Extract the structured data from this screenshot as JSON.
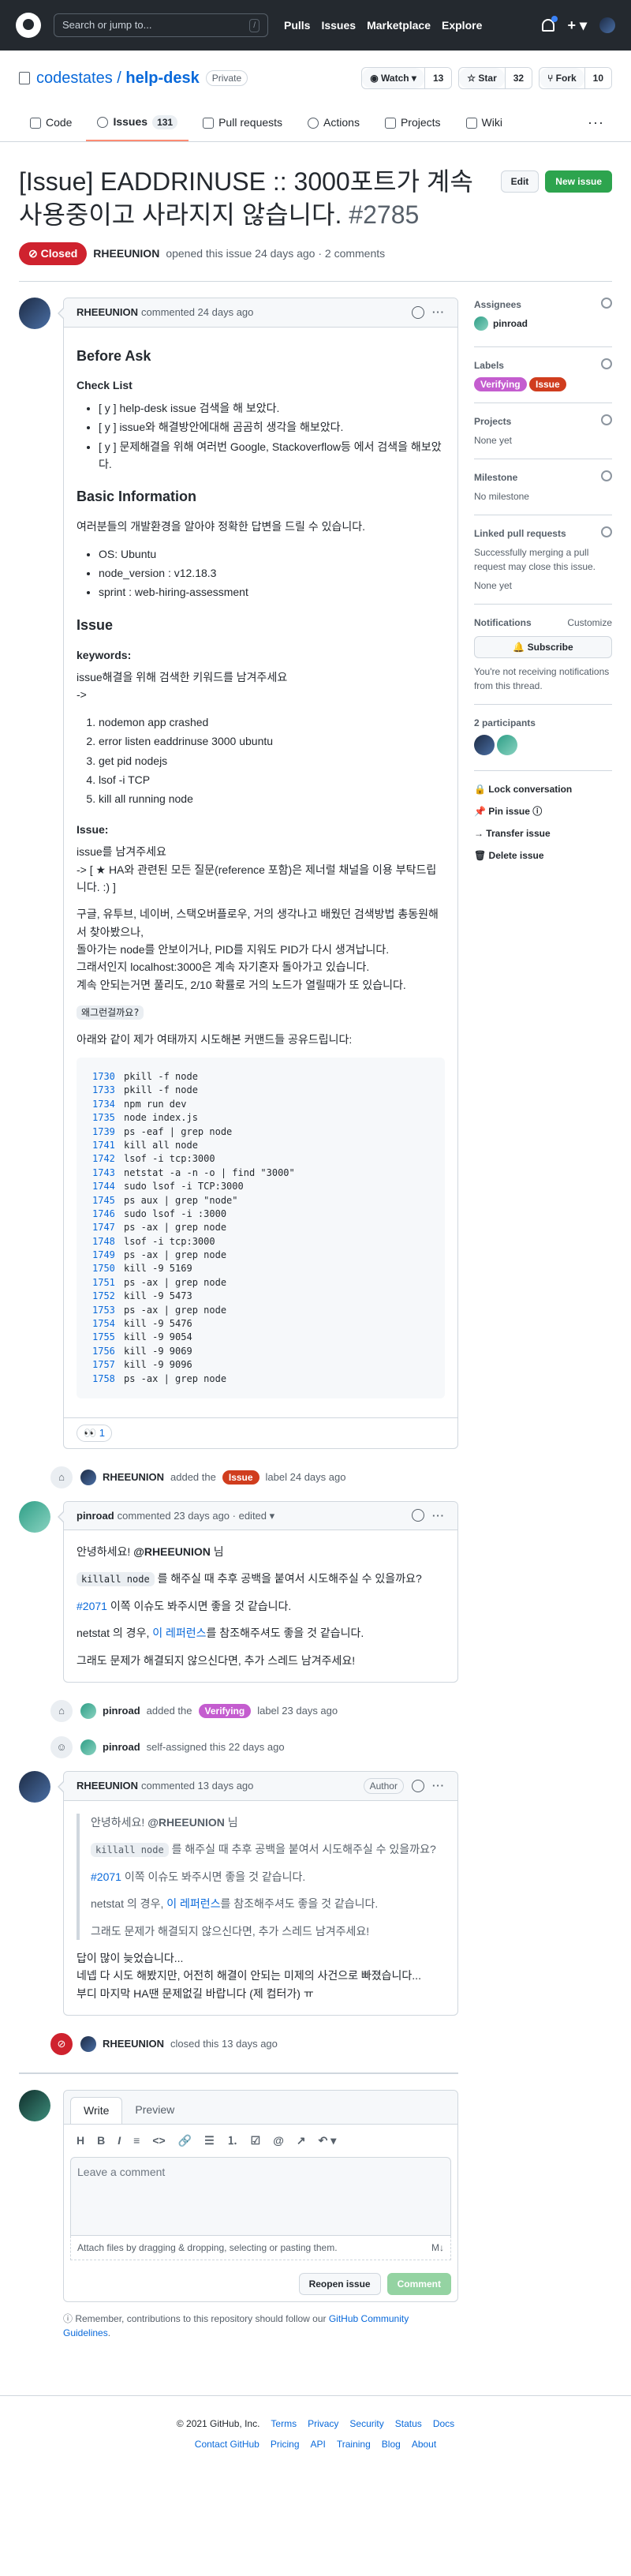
{
  "header": {
    "search_placeholder": "Search or jump to...",
    "search_key": "/",
    "nav": [
      "Pulls",
      "Issues",
      "Marketplace",
      "Explore"
    ],
    "plus": "+ ▾"
  },
  "repo": {
    "owner": "codestates",
    "sep": " / ",
    "name": "help-desk",
    "visibility": "Private",
    "watch_label": "◉ Watch ▾",
    "watch_count": "13",
    "star_label": "☆ Star",
    "star_count": "32",
    "fork_label": "⑂ Fork",
    "fork_count": "10",
    "tabs": [
      {
        "label": "Code"
      },
      {
        "label": "Issues",
        "count": "131"
      },
      {
        "label": "Pull requests"
      },
      {
        "label": "Actions"
      },
      {
        "label": "Projects"
      },
      {
        "label": "Wiki"
      }
    ],
    "more": "···"
  },
  "issue": {
    "title": "[Issue] EADDRINUSE :: 3000포트가 계속 사용중이고 사라지지 않습니다.",
    "number": "#2785",
    "edit": "Edit",
    "new_issue": "New issue",
    "state": "⊘ Closed",
    "author": "RHEEUNION",
    "opened_text": "opened this issue 24 days ago · 2 comments"
  },
  "comment1": {
    "author": "RHEEUNION",
    "time": "commented 24 days ago",
    "h_before": "Before Ask",
    "h_checklist": "Check List",
    "checklist": [
      "[ y ] help-desk issue 검색을 해 보았다.",
      "[ y ] issue와 해결방안에대해 곰곰히 생각을 해보았다.",
      "[ y ] 문제해결을 위해 여러번 Google, Stackoverflow등 에서 검색을 해보았다."
    ],
    "h_basic": "Basic Information",
    "basic_intro": "여러분들의 개발환경을 알아야 정확한 답변을 드릴 수 있습니다.",
    "basic": [
      "OS: Ubuntu",
      "node_version : v12.18.3",
      "sprint : web-hiring-assessment"
    ],
    "h_issue": "Issue",
    "h_keywords": "keywords:",
    "kw_intro": "issue해결을 위해 검색한 키워드를 남겨주세요",
    "kw_arrow": "->",
    "keywords": [
      "nodemon app crashed",
      "error listen eaddrinuse 3000 ubuntu",
      "get pid nodejs",
      "lsof -i TCP",
      "kill all running node"
    ],
    "h_issue2": "Issue:",
    "issue_line1": "issue를 남겨주세요",
    "issue_line2": "-> [ ★ HA와 관련된 모든 질문(reference 포함)은 제너럴 채널을 이용 부탁드립니다. :) ]",
    "para1": "구글, 유투브, 네이버, 스택오버플로우, 거의 생각나고 배웠던 검색방법 총동원해서 찾아봤으나,",
    "para2": "돌아가는 node를 안보이거나, PID를 지워도 PID가 다시 생겨납니다.",
    "para3": "그래서인지 localhost:3000은 계속 자기혼자 돌아가고 있습니다.",
    "para4": "계속 안되는거면 풀리도, 2/10 확률로 거의 노드가 열릴때가 또 있습니다.",
    "chip": "왜그런걸까요?",
    "code_intro": "아래와 같이 제가 여태까지 시도해본 커맨드들 공유드립니다:",
    "code": [
      [
        "1730",
        "pkill -f node"
      ],
      [
        "1733",
        "pkill -f node"
      ],
      [
        "1734",
        "npm run dev"
      ],
      [
        "1735",
        "node index.js"
      ],
      [
        "1739",
        "ps -eaf | grep node"
      ],
      [
        "1741",
        "kill all node"
      ],
      [
        "1742",
        "lsof -i tcp:3000"
      ],
      [
        "1743",
        "netstat -a -n -o | find \"3000\""
      ],
      [
        "1744",
        "sudo lsof -i TCP:3000"
      ],
      [
        "1745",
        "ps aux | grep \"node\""
      ],
      [
        "1746",
        "sudo lsof -i :3000"
      ],
      [
        "1747",
        "ps -ax | grep node"
      ],
      [
        "1748",
        "lsof -i tcp:3000"
      ],
      [
        "1749",
        "ps -ax | grep node"
      ],
      [
        "1750",
        "kill -9 5169"
      ],
      [
        "1751",
        "ps -ax | grep node"
      ],
      [
        "1752",
        "kill -9 5473"
      ],
      [
        "1753",
        "ps -ax | grep node"
      ],
      [
        "1754",
        "kill -9 5476"
      ],
      [
        "1755",
        "kill -9 9054"
      ],
      [
        "1756",
        "kill -9 9069"
      ],
      [
        "1757",
        "kill -9 9096"
      ],
      [
        "1758",
        "ps -ax | grep node"
      ]
    ],
    "reaction": "👀 1"
  },
  "event1": {
    "author": "RHEEUNION",
    "pre": "added the",
    "label": "Issue",
    "post": "label 24 days ago"
  },
  "comment2": {
    "author": "pinroad",
    "time": "commented 23 days ago · edited ▾",
    "greet_pre": "안녕하세요!",
    "greet_mention": "@RHEEUNION",
    "greet_post": "님",
    "l2_code": "killall node",
    "l2_text": "를 해주실 때 추후 공백을 붙여서 시도해주실 수 있을까요?",
    "l3_link": "#2071",
    "l3_text": "이쪽 이슈도 봐주시면 좋을 것 같습니다.",
    "l4_pre": "netstat 의 경우,",
    "l4_link": "이 레퍼런스",
    "l4_post": "를 참조해주셔도 좋을 것 같습니다.",
    "l5": "그래도 문제가 해결되지 않으신다면, 추가 스레드 남겨주세요!"
  },
  "event2": {
    "author": "pinroad",
    "pre": "added the",
    "label": "Verifying",
    "post": "label 23 days ago"
  },
  "event3": {
    "author": "pinroad",
    "text": "self-assigned this 22 days ago"
  },
  "comment3": {
    "author": "RHEEUNION",
    "time": "commented 13 days ago",
    "badge": "Author",
    "reply1": "답이 많이 늦었습니다...",
    "reply2": "네넵 다 시도 해봤지만, 어전히 해결이 안되는 미제의 사건으로 빠졌습니다...",
    "reply3": "부디 마지막 HA땐 문제없길 바랍니다 (제 컴터가) ㅠ"
  },
  "event4": {
    "author": "RHEEUNION",
    "text": "closed this 13 days ago"
  },
  "composer": {
    "tab_write": "Write",
    "tab_preview": "Preview",
    "tools": [
      "H",
      "B",
      "I",
      "≡",
      "<>",
      "🔗",
      "☰",
      "⒈",
      "☑",
      "@",
      "↗",
      "↶ ▾"
    ],
    "placeholder": "Leave a comment",
    "attach": "Attach files by dragging & dropping, selecting or pasting them.",
    "md": "M↓",
    "reopen": "Reopen issue",
    "comment": "Comment"
  },
  "remind": {
    "text": "Remember, contributions to this repository should follow our",
    "link": "GitHub Community Guidelines",
    "end": "."
  },
  "sidebar": {
    "assignees_title": "Assignees",
    "assignee": "pinroad",
    "labels_title": "Labels",
    "labels": [
      "Verifying",
      "Issue"
    ],
    "projects_title": "Projects",
    "projects_value": "None yet",
    "milestone_title": "Milestone",
    "milestone_value": "No milestone",
    "linked_title": "Linked pull requests",
    "linked_desc": "Successfully merging a pull request may close this issue.",
    "linked_value": "None yet",
    "notif_title": "Notifications",
    "notif_customize": "Customize",
    "subscribe": "🔔 Subscribe",
    "notif_desc": "You're not receiving notifications from this thread.",
    "participants": "2 participants",
    "actions": [
      "🔒 Lock conversation",
      "📌 Pin issue ⓘ",
      "→ Transfer issue",
      "🗑 Delete issue"
    ]
  },
  "footer": {
    "row1": [
      "© 2021 GitHub, Inc.",
      "Terms",
      "Privacy",
      "Security",
      "Status",
      "Docs"
    ],
    "row2": [
      "Contact GitHub",
      "Pricing",
      "API",
      "Training",
      "Blog",
      "About"
    ]
  }
}
